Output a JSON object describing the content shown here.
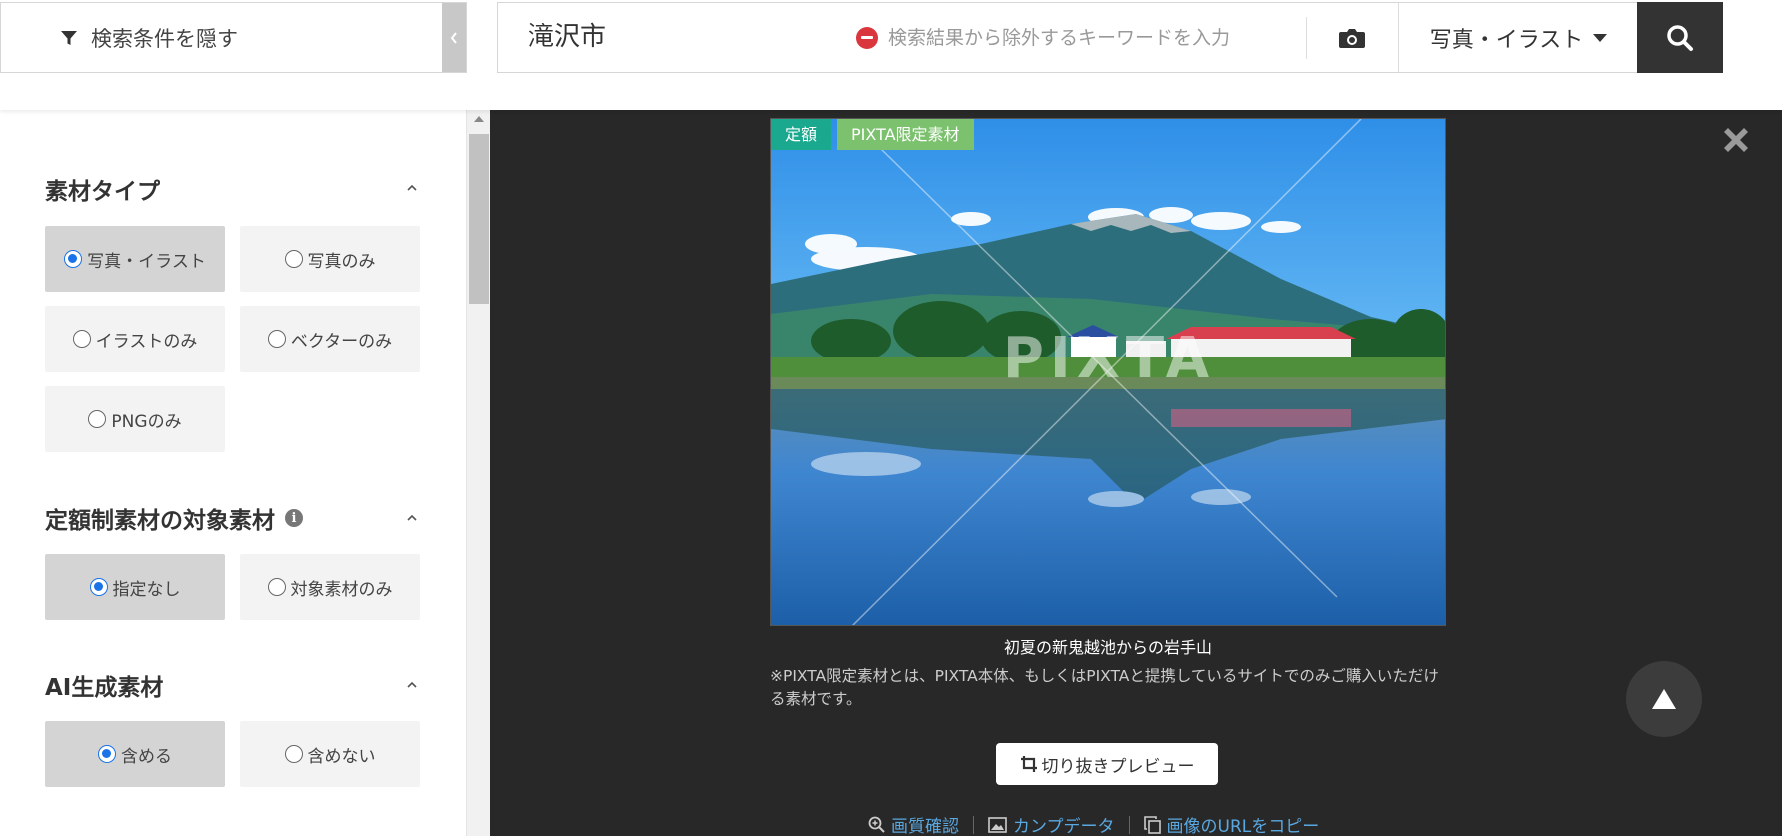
{
  "topbar": {
    "hide_filter_label": "検索条件を隠す",
    "search_query": "滝沢市",
    "exclude_placeholder": "検索結果から除外するキーワードを入力",
    "type_select_value": "写真・イラスト"
  },
  "sidebar": {
    "material_type": {
      "title": "素材タイプ",
      "options": [
        "写真・イラスト",
        "写真のみ",
        "イラストのみ",
        "ベクターのみ",
        "PNGのみ"
      ],
      "selected": "写真・イラスト"
    },
    "subscription": {
      "title": "定額制素材の対象素材",
      "options": [
        "指定なし",
        "対象素材のみ"
      ],
      "selected": "指定なし"
    },
    "ai_generated": {
      "title": "AI生成素材",
      "options": [
        "含める",
        "含めない"
      ],
      "selected": "含める"
    }
  },
  "preview": {
    "badge_fixed": "定額",
    "badge_limited": "PIXTA限定素材",
    "watermark": "PIXTA",
    "caption": "初夏の新鬼越池からの岩手山",
    "note": "※PIXTA限定素材とは、PIXTA本体、もしくはPIXTAと提携しているサイトでのみご購入いただける素材です。",
    "crop_button": "切り抜きプレビュー",
    "links": {
      "quality": "画質確認",
      "comp_data": "カンプデータ",
      "copy_url": "画像のURLをコピー"
    }
  },
  "colors": {
    "accent_blue": "#1a73e8",
    "badge_teal": "#1aa98f",
    "badge_green": "#7cc16e",
    "link_blue": "#5aa8e0",
    "dark_panel": "#282828"
  }
}
